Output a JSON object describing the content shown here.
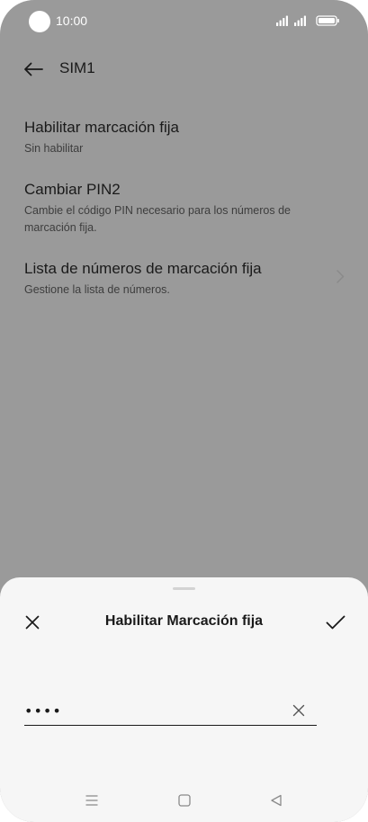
{
  "status_bar": {
    "time": "10:00"
  },
  "header": {
    "title": "SIM1"
  },
  "settings": {
    "items": [
      {
        "title": "Habilitar marcación fija",
        "subtitle": "Sin habilitar"
      },
      {
        "title": "Cambiar PIN2",
        "subtitle": "Cambie el código PIN necesario para los números de marcación fija."
      },
      {
        "title": "Lista de números de marcación fija",
        "subtitle": "Gestione la lista de números."
      }
    ]
  },
  "sheet": {
    "title": "Habilitar Marcación fija",
    "pin_value": "••••"
  },
  "colors": {
    "background_dim": "#9a9a9a",
    "sheet_background": "#f6f6f6",
    "text_primary": "#1a1a1a"
  },
  "icons": {
    "back": "arrow-left-icon",
    "chevron": "chevron-right-icon",
    "close": "close-icon",
    "confirm": "checkmark-icon",
    "clear": "clear-icon",
    "nav_menu": "menu-icon",
    "nav_home": "home-icon",
    "nav_back": "back-triangle-icon"
  }
}
